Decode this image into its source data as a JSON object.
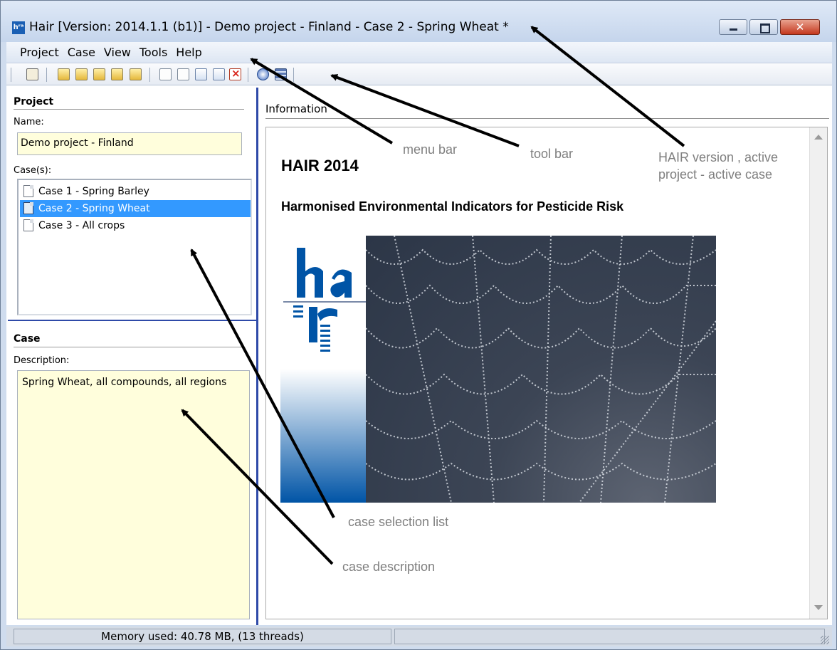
{
  "window": {
    "title": "Hair [Version: 2014.1.1 (b1)] - Demo project - Finland - Case 2 - Spring Wheat *",
    "app_icon_text": "hʳᵃ",
    "close_glyph": "✕"
  },
  "menubar": {
    "items": [
      "Project",
      "Case",
      "View",
      "Tools",
      "Help"
    ]
  },
  "toolbar": {
    "icons": [
      "home-icon",
      "new-project-icon",
      "open-project-icon",
      "save-project-icon",
      "project-properties-icon",
      "export-project-icon",
      "new-case-icon",
      "preview-case-icon",
      "edit-case-icon",
      "run-case-icon",
      "delete-case-icon",
      "help-icon",
      "calculator-icon"
    ]
  },
  "project": {
    "title": "Project",
    "name_label": "Name:",
    "name_value": "Demo project - Finland",
    "cases_label": "Case(s):",
    "cases": [
      {
        "label": "Case 1 - Spring Barley",
        "selected": false
      },
      {
        "label": "Case 2 - Spring Wheat",
        "selected": true
      },
      {
        "label": "Case 3 - All crops",
        "selected": false
      }
    ]
  },
  "case": {
    "title": "Case",
    "description_label": "Description:",
    "description_value": "Spring Wheat, all compounds, all regions"
  },
  "information": {
    "label": "Information",
    "heading": "HAIR 2014",
    "subheading": "Harmonised Environmental Indicators for Pesticide Risk"
  },
  "annotations": {
    "menu_bar": "menu bar",
    "tool_bar": "tool bar",
    "hair_version_line1": "HAIR version , active",
    "hair_version_line2": "project - active case",
    "case_selection_list": "case selection list",
    "case_description": "case description"
  },
  "statusbar": {
    "memory": "Memory used: 40.78 MB, (13 threads)"
  },
  "colors": {
    "selection": "#3399ff",
    "field_background": "#fffedc",
    "divider": "#2e4aa8",
    "logo_blue": "#0054a6"
  }
}
